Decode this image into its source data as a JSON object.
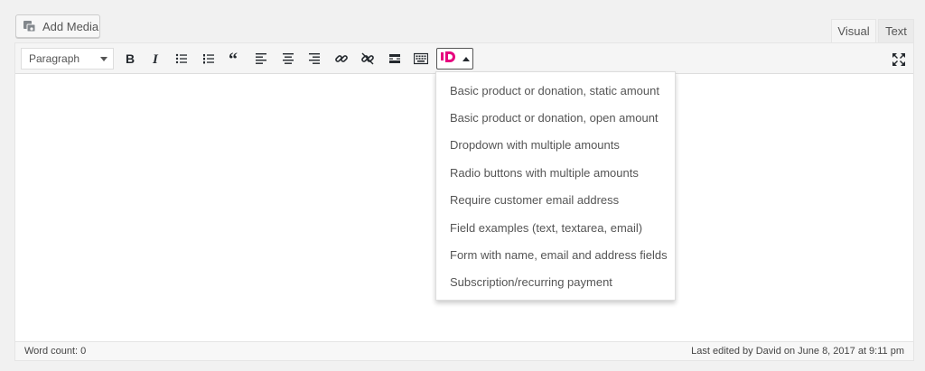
{
  "media_button": {
    "label": "Add Media",
    "icon": "media-icon"
  },
  "tabs": [
    {
      "label": "Visual",
      "active": true
    },
    {
      "label": "Text",
      "active": false
    }
  ],
  "toolbar": {
    "format_select": {
      "value": "Paragraph",
      "options_visible": [
        "Paragraph"
      ]
    },
    "buttons": [
      "bold-icon",
      "italic-icon",
      "bulleted-list-icon",
      "numbered-list-icon",
      "blockquote-icon",
      "align-left-icon",
      "align-center-icon",
      "align-right-icon",
      "insert-link-icon",
      "remove-link-icon",
      "read-more-icon",
      "toolbar-toggle-icon"
    ],
    "plugin_icon": "donation-form-icon",
    "plugin_brand_color": "#e6007e",
    "fullscreen_icon": "fullscreen-icon"
  },
  "dropdown": {
    "items": [
      "Basic product or donation, static amount",
      "Basic product or donation, open amount",
      "Dropdown with multiple amounts",
      "Radio buttons with multiple amounts",
      "Require customer email address",
      "Field examples (text, textarea, email)",
      "Form with name, email and address fields",
      "Subscription/recurring payment"
    ]
  },
  "status": {
    "word_count": "Word count: 0",
    "last_edited": "Last edited by David on June 8, 2017 at 9:11 pm"
  }
}
